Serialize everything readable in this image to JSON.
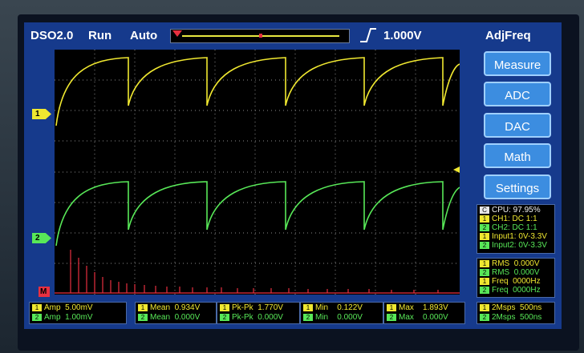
{
  "header": {
    "model": "DSO2.0",
    "run_state": "Run",
    "trigger_mode": "Auto",
    "trigger_level": "1.000V",
    "right_title": "AdjFreq"
  },
  "menu": [
    "Measure",
    "ADC",
    "DAC",
    "Math",
    "Settings"
  ],
  "channel_markers": {
    "ch1": "1",
    "ch2": "2",
    "math": "M"
  },
  "status_panel": {
    "c_tag": "C",
    "cpu": "CPU: 97.95%",
    "ch1": "CH1: DC 1:1",
    "ch2": "CH2: DC 1:1",
    "input1": "Input1: 0V-3.3V",
    "input2": "Input2: 0V-3.3V"
  },
  "rms_panel": {
    "rows": [
      {
        "tag": "1",
        "label": "RMS",
        "value": "0.000V"
      },
      {
        "tag": "2",
        "label": "RMS",
        "value": "0.000V"
      },
      {
        "tag": "1",
        "label": "Freq",
        "value": "0000Hz"
      },
      {
        "tag": "2",
        "label": "Freq",
        "value": "0000Hz"
      }
    ]
  },
  "bottom": {
    "amp": [
      {
        "tag": "1",
        "label": "Amp",
        "value": "5.00mV"
      },
      {
        "tag": "2",
        "label": "Amp",
        "value": "1.00mV"
      }
    ],
    "mean": [
      {
        "tag": "1",
        "label": "Mean",
        "value": "0.934V"
      },
      {
        "tag": "2",
        "label": "Mean",
        "value": "0.000V"
      }
    ],
    "pkpk": [
      {
        "tag": "1",
        "label": "Pk-Pk",
        "value": "1.770V"
      },
      {
        "tag": "2",
        "label": "Pk-Pk",
        "value": "0.000V"
      }
    ],
    "min": [
      {
        "tag": "1",
        "label": "Min",
        "value": "0.122V"
      },
      {
        "tag": "2",
        "label": "Min",
        "value": "0.000V"
      }
    ],
    "max": [
      {
        "tag": "1",
        "label": "Max",
        "value": "1.893V"
      },
      {
        "tag": "2",
        "label": "Max",
        "value": "0.000V"
      }
    ],
    "rate": [
      {
        "tag": "1",
        "label": "2Msps",
        "value": "500ns"
      },
      {
        "tag": "2",
        "label": "2Msps",
        "value": "500ns"
      }
    ]
  },
  "colors": {
    "ch1": "#f0e830",
    "ch2": "#58e858",
    "math": "#e83040",
    "screen": "#163a8c",
    "button": "#3c8de0"
  }
}
